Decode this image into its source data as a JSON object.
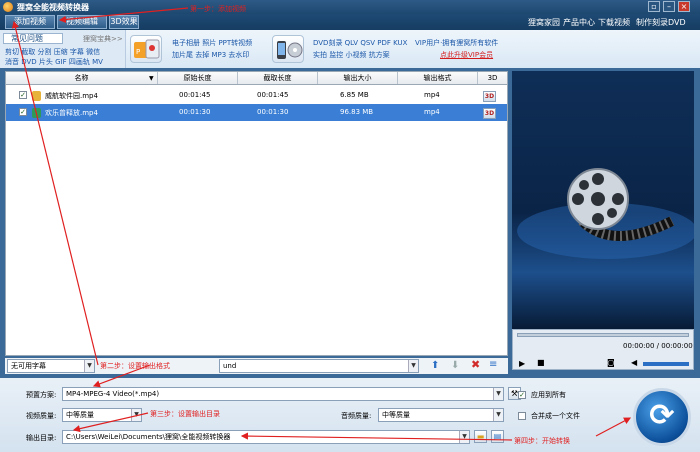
{
  "app": {
    "title": "狸窝全能视频转换器"
  },
  "window": {
    "min": "–",
    "max": "□",
    "close": "×",
    "restore": "▫"
  },
  "toolbar": {
    "add_video": "添加视频",
    "edit_video": "视频编辑",
    "effects_3d": "3D效果"
  },
  "top_links": [
    "狸窝家园",
    "产品中心",
    "下载视频",
    "制作刻录DVD"
  ],
  "ad": {
    "tab": "常见问题",
    "tab_aux": "狸窝宝典>>",
    "keywords_a": [
      "剪切 截取 分割 压缩 字幕 微信",
      "消音 DVD 片头 GIF 四画轨 MV"
    ],
    "keywords_b": [
      "电子相册 照片 PPT转视频",
      "加片尾 去掉 MP3 去水印"
    ],
    "keywords_c": [
      "DVD刻录 QLV QSV PDF KUX",
      "实拍 监控 小视频 抗方案"
    ],
    "vip_line1": "VIP用户·拥有狸窝所有软件",
    "vip_link": "点此升级VIP会员",
    "accent": "#1b57a8",
    "link_color": "#d41c1c"
  },
  "table": {
    "headers": [
      "名称",
      "原始长度",
      "截取长度",
      "输出大小",
      "输出格式",
      "3D"
    ],
    "rows": [
      {
        "name": "威航软件园.mp4",
        "orig": "00:01:45",
        "cut": "00:01:45",
        "size": "6.85 MB",
        "format": "mp4",
        "three_d": "3D"
      },
      {
        "name": "欢乐曾释放.mp4",
        "orig": "00:01:30",
        "cut": "00:01:30",
        "size": "96.83 MB",
        "format": "mp4",
        "three_d": "3D"
      }
    ]
  },
  "player": {
    "time": "00:00:00 / 00:00:00"
  },
  "subtitle": {
    "value": "无可用字幕",
    "audio": "und"
  },
  "settings": {
    "preset_label": "预置方案:",
    "preset_value": "MP4-MPEG-4 Video(*.mp4)",
    "video_quality_label": "视频质量:",
    "video_quality_value": "中等质量",
    "audio_quality_label": "音频质量:",
    "audio_quality_value": "中等质量",
    "output_dir_label": "输出目录:",
    "output_dir_value": "C:\\Users\\WeiLei\\Documents\\狸窝\\全能视频转换器",
    "apply_all": "应用到所有",
    "merge_one": "合并成一个文件"
  },
  "notes": {
    "step1": "第一步：添加视频",
    "step2": "第二步：设置输出格式",
    "step3": "第三步：设置输出目录",
    "step4": "第四步：开始转换"
  },
  "colors": {
    "selection": "#3a7fd5",
    "note": "#e02020"
  }
}
